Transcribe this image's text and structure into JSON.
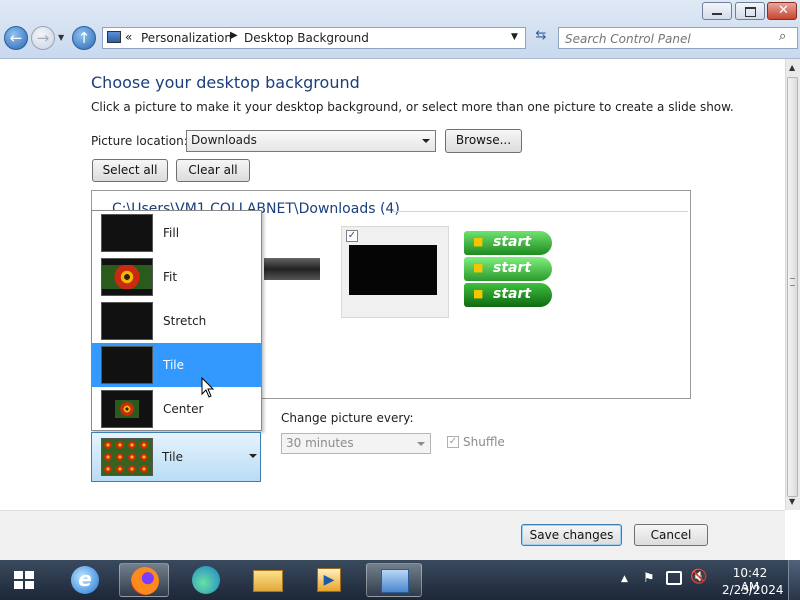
{
  "address": {
    "overflow": "«",
    "crumbs": [
      "Personalization",
      "Desktop Background"
    ]
  },
  "search": {
    "placeholder": "Search Control Panel"
  },
  "main": {
    "heading": "Choose your desktop background",
    "subtitle": "Click a picture to make it your desktop background, or select more than one picture to create a slide show.",
    "picture_location_label": "Picture location:",
    "picture_location_value": "Downloads",
    "browse_label": "Browse...",
    "select_all_label": "Select all",
    "clear_all_label": "Clear all",
    "folder_header": "C:\\Users\\VM1.COLLABNET\\Downloads (4)"
  },
  "position_menu": {
    "items": [
      {
        "label": "Fill"
      },
      {
        "label": "Fit"
      },
      {
        "label": "Stretch"
      },
      {
        "label": "Tile"
      },
      {
        "label": "Center"
      }
    ],
    "selected_label": "Tile"
  },
  "slideshow": {
    "change_label": "Change picture every:",
    "interval_value": "30 minutes",
    "shuffle_label": "Shuffle"
  },
  "footer": {
    "save_label": "Save changes",
    "cancel_label": "Cancel"
  },
  "thumbnails": {
    "start_button_text": "start"
  },
  "taskbar": {
    "time": "10:42 AM",
    "date": "2/23/2024"
  },
  "colors": {
    "heading": "#1a3f7a",
    "menu_selection": "#3399ff"
  }
}
